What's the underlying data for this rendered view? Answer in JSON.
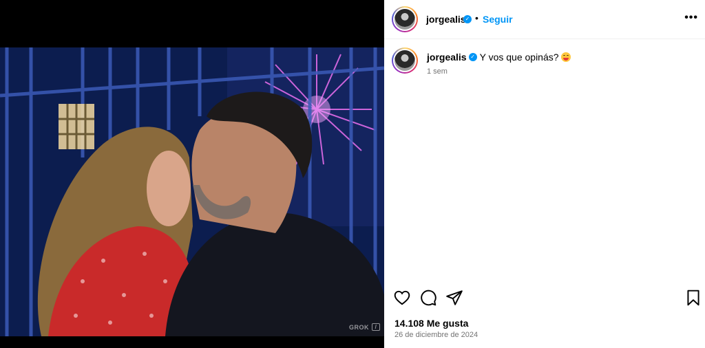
{
  "media": {
    "watermark": "GROK",
    "watermark_mark": "/"
  },
  "header": {
    "username": "jorgealis",
    "verified_mark": "✓",
    "separator": "•",
    "follow_label": "Seguir",
    "more_label": "•••"
  },
  "caption": {
    "username": "jorgealis",
    "verified_mark": "✓",
    "text": "Y vos que opinás?",
    "time": "1 sem"
  },
  "actions": {
    "like_icon": "heart-icon",
    "comment_icon": "comment-icon",
    "share_icon": "paper-plane-icon",
    "save_icon": "bookmark-icon"
  },
  "stats": {
    "likes": "14.108 Me gusta",
    "date": "26 de diciembre de 2024"
  },
  "colors": {
    "follow": "#0095f6",
    "verified": "#0095f6",
    "muted": "#737373"
  }
}
